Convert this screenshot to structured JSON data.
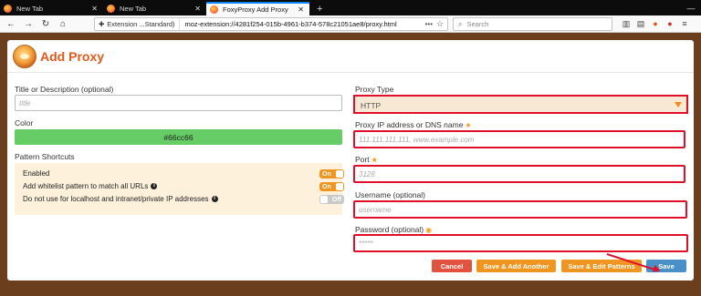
{
  "browser": {
    "tabs": [
      {
        "label": "New Tab",
        "active": false
      },
      {
        "label": "New Tab",
        "active": false
      },
      {
        "label": "FoxyProxy Add Proxy",
        "active": true
      }
    ],
    "url_extension_label": "Extension ...Standard)",
    "url": "moz-extension://4281f254-015b-4961-b374-578c21051ae8/proxy.html",
    "search_placeholder": "Search"
  },
  "page": {
    "title": "Add Proxy",
    "title_label": "Title or Description (optional)",
    "title_placeholder": "title",
    "color_label": "Color",
    "color_value": "#66cc66",
    "shortcuts_label": "Pattern Shortcuts",
    "shortcuts": [
      {
        "label": "Enabled",
        "state": "On",
        "info": false
      },
      {
        "label": "Add whitelist pattern to match all URLs",
        "state": "On",
        "info": true
      },
      {
        "label": "Do not use for localhost and intranet/private IP addresses",
        "state": "Off",
        "info": true
      }
    ],
    "proxy_type_label": "Proxy Type",
    "proxy_type_value": "HTTP",
    "ip_label": "Proxy IP address or DNS name",
    "ip_placeholder": "111.111.111.111, www.example.com",
    "port_label": "Port",
    "port_placeholder": "3128",
    "username_label": "Username (optional)",
    "username_placeholder": "username",
    "password_label": "Password (optional)",
    "password_placeholder": "*****",
    "buttons": {
      "cancel": "Cancel",
      "save_add_another": "Save & Add Another",
      "save_edit_patterns": "Save & Edit Patterns",
      "save": "Save"
    }
  },
  "colors": {
    "accent": "#e05a1b",
    "highlight": "#e0102b",
    "toggle_on": "#f0951f",
    "save": "#4a90c8",
    "cancel": "#e2533f",
    "orange_btn": "#f0951f"
  }
}
